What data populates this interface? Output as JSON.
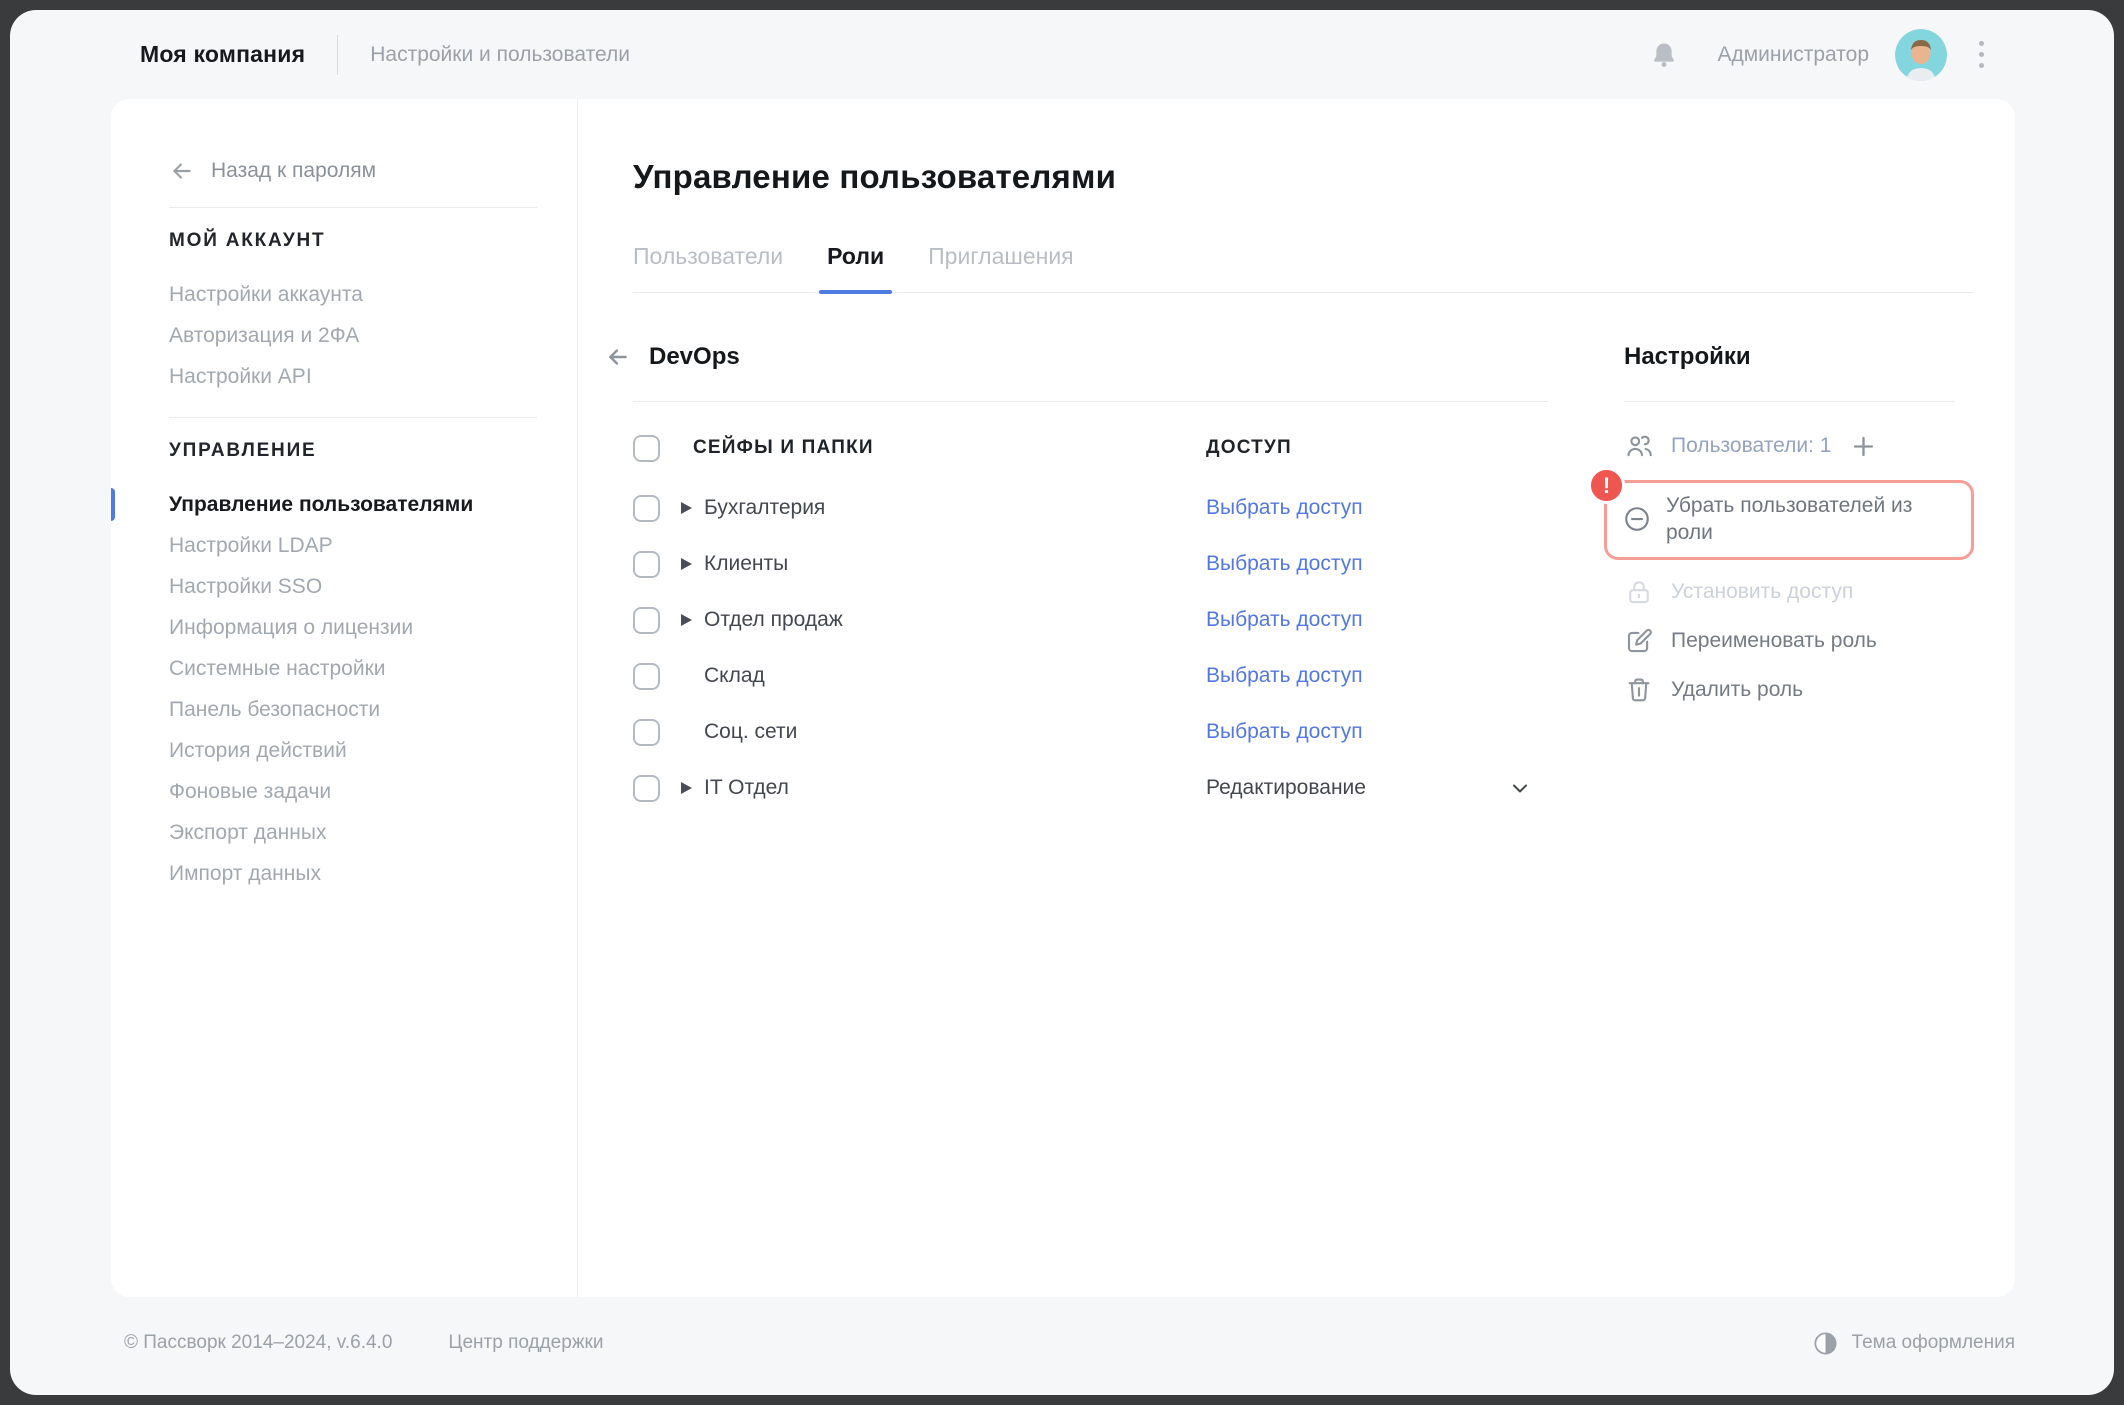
{
  "topbar": {
    "company": "Моя компания",
    "section": "Настройки и пользователи",
    "user": "Администратор"
  },
  "sidebar": {
    "back_label": "Назад к паролям",
    "account_header": "МОЙ АККАУНТ",
    "account_items": [
      {
        "label": "Настройки аккаунта"
      },
      {
        "label": "Авторизация и 2ФА"
      },
      {
        "label": "Настройки API"
      }
    ],
    "admin_header": "УПРАВЛЕНИЕ",
    "admin_items": [
      {
        "label": "Управление пользователями",
        "active": true
      },
      {
        "label": "Настройки LDAP"
      },
      {
        "label": "Настройки SSO"
      },
      {
        "label": "Информация о лицензии"
      },
      {
        "label": "Системные настройки"
      },
      {
        "label": "Панель безопасности"
      },
      {
        "label": "История действий"
      },
      {
        "label": "Фоновые задачи"
      },
      {
        "label": "Экспорт данных"
      },
      {
        "label": "Импорт данных"
      }
    ]
  },
  "main": {
    "title": "Управление пользователями",
    "tabs": [
      {
        "label": "Пользователи"
      },
      {
        "label": "Роли",
        "active": true
      },
      {
        "label": "Приглашения"
      }
    ],
    "role": {
      "name": "DevOps",
      "columns": {
        "safes": "СЕЙФЫ И ПАПКИ",
        "access": "ДОСТУП"
      },
      "rows": [
        {
          "label": "Бухгалтерия",
          "expandable": true,
          "access": "Выбрать доступ"
        },
        {
          "label": "Клиенты",
          "expandable": true,
          "access": "Выбрать доступ"
        },
        {
          "label": "Отдел продаж",
          "expandable": true,
          "access": "Выбрать доступ"
        },
        {
          "label": "Склад",
          "access": "Выбрать доступ"
        },
        {
          "label": "Соц. сети",
          "access": "Выбрать доступ"
        },
        {
          "label": "IT Отдел",
          "expandable": true,
          "access": "Редактирование",
          "is_dropdown": true
        }
      ]
    },
    "settings_panel": {
      "title": "Настройки",
      "users_label": "Пользователи: 1",
      "alert_badge": "!",
      "remove_users": "Убрать пользователей из роли",
      "set_access": "Установить доступ",
      "rename_role": "Переименовать роль",
      "delete_role": "Удалить роль"
    }
  },
  "footer": {
    "copyright": "© Пассворк 2014–2024, v.6.4.0",
    "support": "Центр поддержки",
    "theme": "Тема оформления"
  },
  "colors": {
    "accent_blue": "#4f7ce2",
    "link_blue": "#5379e1",
    "alert_red": "#ef5551",
    "alert_border": "#f59e97"
  }
}
